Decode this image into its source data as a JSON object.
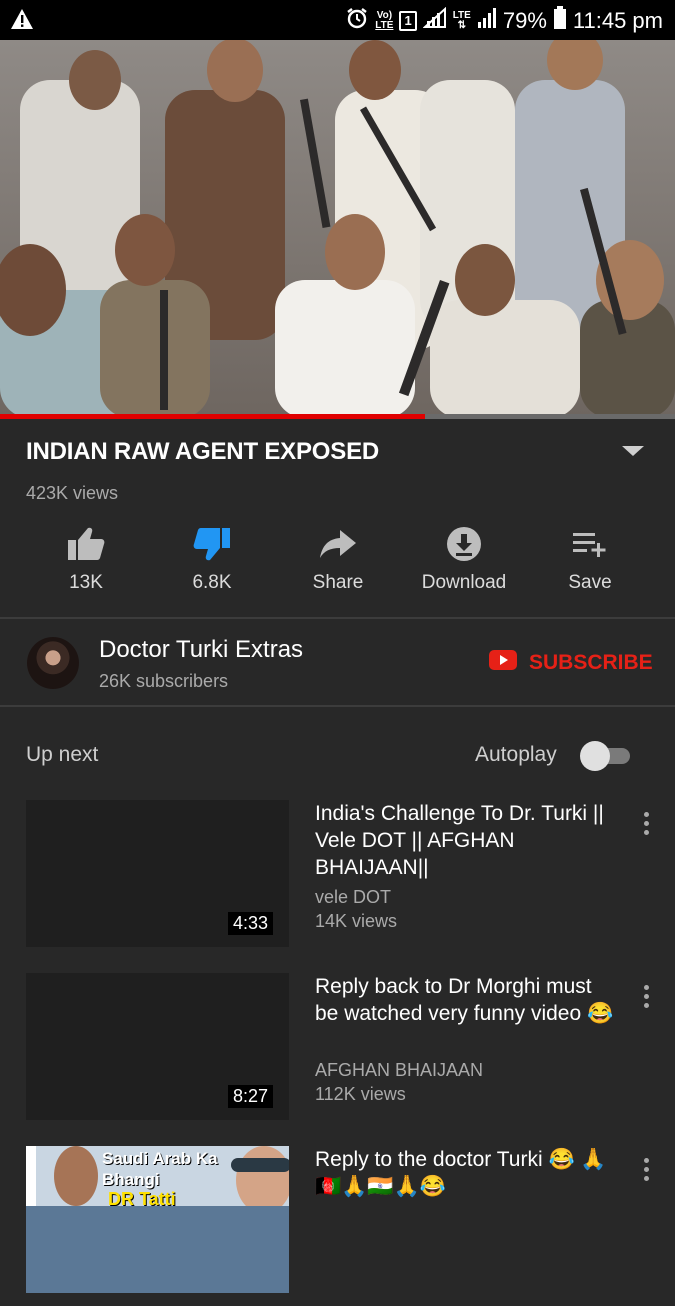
{
  "status_bar": {
    "volte": "Vo)",
    "lte_small": "LTE",
    "sim": "1",
    "lte": "LTE",
    "battery": "79%",
    "time": "11:45 pm"
  },
  "video": {
    "title": "INDIAN RAW AGENT EXPOSED",
    "views": "423K views",
    "progress": 0.63
  },
  "actions": [
    {
      "icon": "thumbs-up-icon",
      "label": "13K"
    },
    {
      "icon": "thumbs-down-icon",
      "label": "6.8K"
    },
    {
      "icon": "share-icon",
      "label": "Share"
    },
    {
      "icon": "download-icon",
      "label": "Download"
    },
    {
      "icon": "playlist-add-icon",
      "label": "Save"
    }
  ],
  "channel": {
    "name": "Doctor Turki Extras",
    "subscribers": "26K subscribers",
    "subscribe_label": "SUBSCRIBE"
  },
  "up_next": {
    "label": "Up next",
    "autoplay_label": "Autoplay"
  },
  "items": [
    {
      "title": "India's Challenge To Dr. Turki || Vele DOT || AFGHAN BHAIJAAN||",
      "channel": "vele DOT",
      "views": "14K views",
      "duration": "4:33"
    },
    {
      "title": "Reply back to Dr Morghi must be watched very funny video 😂",
      "channel": "AFGHAN BHAIJAAN",
      "views": "112K views",
      "duration": "8:27"
    },
    {
      "title": "Reply to the doctor Turki 😂 🙏🇦🇫🙏🇮🇳🙏😂",
      "thumb_text": "Saudi Arab Ka Bhangi",
      "thumb_text2": "DR Tatti"
    }
  ],
  "colors": {
    "background": "#282828",
    "accent_red": "#e62117",
    "dislike_active": "#2196f3"
  }
}
